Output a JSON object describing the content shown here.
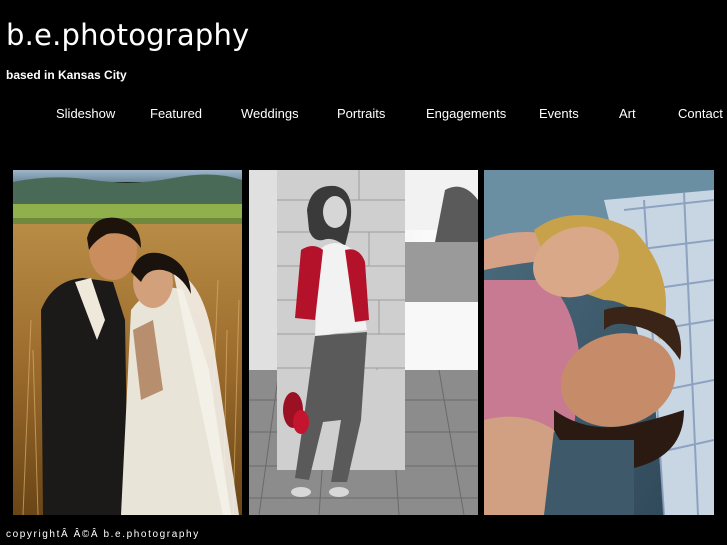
{
  "header": {
    "title": "b.e.photography",
    "tagline": "based in Kansas City"
  },
  "nav": {
    "items": [
      {
        "label": "Slideshow"
      },
      {
        "label": "Featured"
      },
      {
        "label": "Weddings"
      },
      {
        "label": "Portraits"
      },
      {
        "label": "Engagements"
      },
      {
        "label": "Events"
      },
      {
        "label": "Art"
      },
      {
        "label": "Contact"
      }
    ]
  },
  "gallery": {
    "photos": [
      {
        "subject": "wedding couple in golden field"
      },
      {
        "subject": "girl in red cardigan leaning on stone pillar"
      },
      {
        "subject": "couple lying on ground"
      }
    ]
  },
  "footer": {
    "copyright": "copyrightÂ Â©Â b.e.photography"
  }
}
